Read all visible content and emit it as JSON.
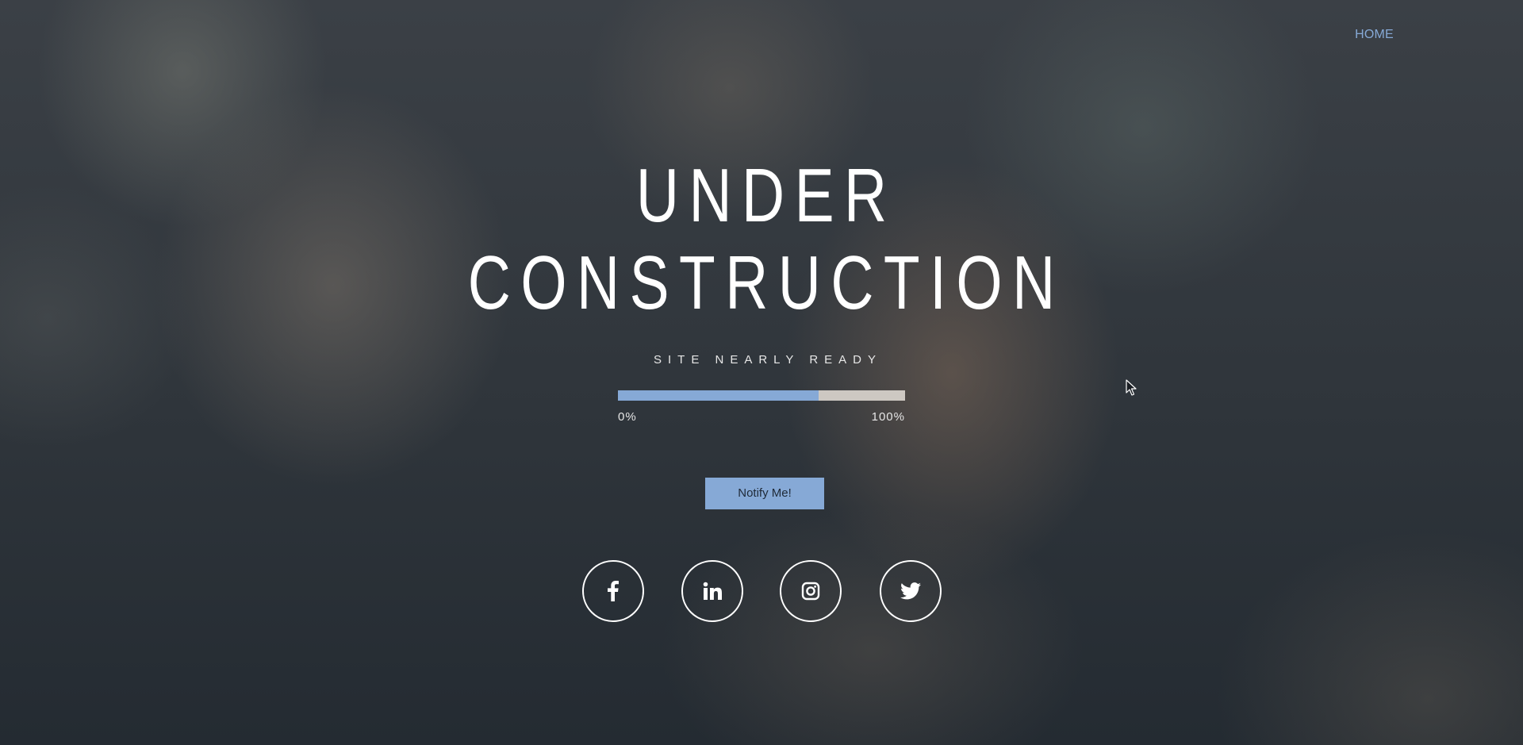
{
  "nav": {
    "items": [
      {
        "label": "HOME"
      }
    ]
  },
  "hero": {
    "title_line1": "UNDER",
    "title_line2": "CONSTRUCTION",
    "subtitle": "SITE NEARLY READY"
  },
  "progress": {
    "value_percent": 70,
    "min_label": "0%",
    "max_label": "100%"
  },
  "cta": {
    "notify_label": "Notify Me!"
  },
  "social": [
    {
      "icon": "facebook-icon"
    },
    {
      "icon": "linkedin-icon"
    },
    {
      "icon": "instagram-icon"
    },
    {
      "icon": "twitter-icon"
    }
  ],
  "colors": {
    "accent": "#86a9d6",
    "progress_track": "#cdc8c2",
    "text": "#ffffff",
    "background": "#2b3037"
  }
}
